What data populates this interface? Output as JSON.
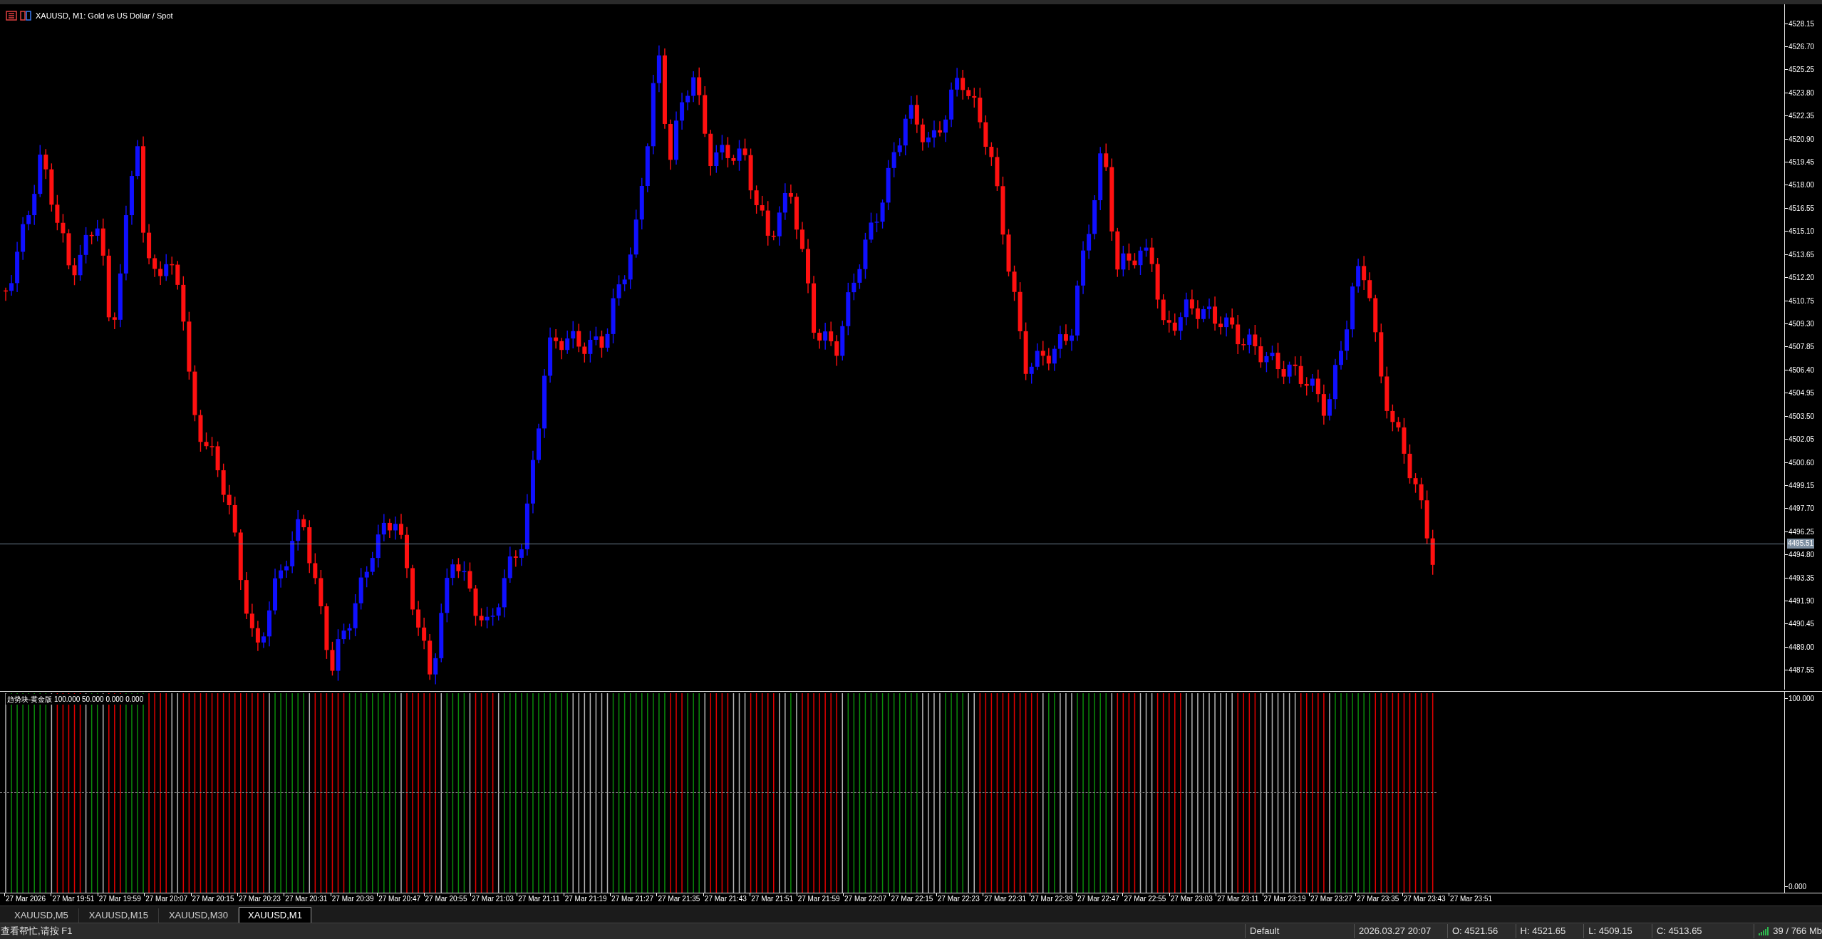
{
  "window": {
    "title": "XAUUSD, M1:  Gold vs US Dollar / Spot"
  },
  "price_axis": {
    "labels": [
      "4528.15",
      "4526.70",
      "4525.25",
      "4523.80",
      "4522.35",
      "4520.90",
      "4519.45",
      "4518.00",
      "4516.55",
      "4515.10",
      "4513.65",
      "4512.20",
      "4510.75",
      "4509.30",
      "4507.85",
      "4506.40",
      "4504.95",
      "4503.50",
      "4502.05",
      "4500.60",
      "4499.15",
      "4497.70",
      "4496.25",
      "4494.80",
      "4493.35",
      "4491.90",
      "4490.45",
      "4489.00",
      "4487.55"
    ],
    "current_price": "4495.51"
  },
  "indicator": {
    "label": "趋势块-黄金版 100.000 50.000 0.000 0.000",
    "axis_labels": [
      "100.000",
      "0.000"
    ]
  },
  "time_axis": [
    "27 Mar 2026",
    "27 Mar 19:51",
    "27 Mar 19:59",
    "27 Mar 20:07",
    "27 Mar 20:15",
    "27 Mar 20:23",
    "27 Mar 20:31",
    "27 Mar 20:39",
    "27 Mar 20:47",
    "27 Mar 20:55",
    "27 Mar 21:03",
    "27 Mar 21:11",
    "27 Mar 21:19",
    "27 Mar 21:27",
    "27 Mar 21:35",
    "27 Mar 21:43",
    "27 Mar 21:51",
    "27 Mar 21:59",
    "27 Mar 22:07",
    "27 Mar 22:15",
    "27 Mar 22:23",
    "27 Mar 22:31",
    "27 Mar 22:39",
    "27 Mar 22:47",
    "27 Mar 22:55",
    "27 Mar 23:03",
    "27 Mar 23:11",
    "27 Mar 23:19",
    "27 Mar 23:27",
    "27 Mar 23:35",
    "27 Mar 23:43",
    "27 Mar 23:51"
  ],
  "tabs": [
    {
      "label": "XAUUSD,M5",
      "selected": false
    },
    {
      "label": "XAUUSD,M15",
      "selected": false
    },
    {
      "label": "XAUUSD,M30",
      "selected": false
    },
    {
      "label": "XAUUSD,M1",
      "selected": true
    }
  ],
  "status_bar": {
    "help": "查看帮忙,请按 F1",
    "profile": "Default",
    "time": "2026.03.27 20:07",
    "open": "O: 4521.56",
    "high": "H: 4521.65",
    "low": "L: 4509.15",
    "close": "C: 4513.65",
    "memory": "39 / 766 Mb"
  }
}
